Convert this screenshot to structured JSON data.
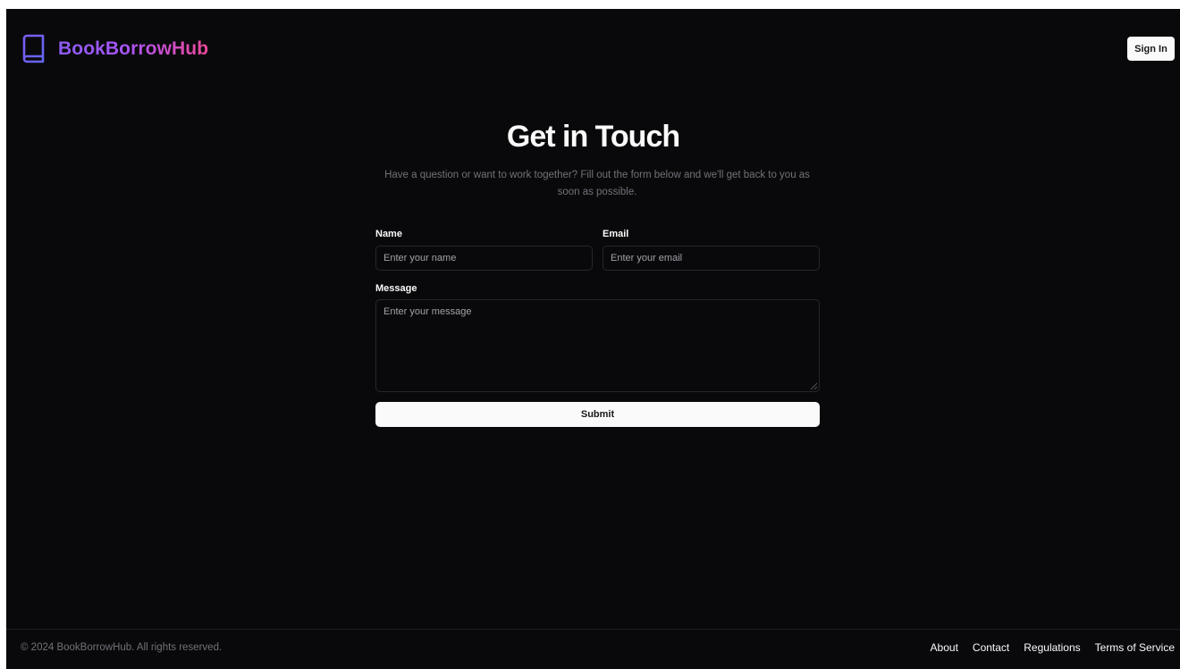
{
  "header": {
    "brand_name": "BookBorrowHub",
    "brand_icon": "book-icon",
    "signin_label": "Sign In"
  },
  "hero": {
    "title": "Get in Touch",
    "subtitle": "Have a question or want to work together? Fill out the form below and we'll get back to you as soon as possible."
  },
  "form": {
    "name_label": "Name",
    "name_placeholder": "Enter your name",
    "name_value": "",
    "email_label": "Email",
    "email_placeholder": "Enter your email",
    "email_value": "",
    "message_label": "Message",
    "message_placeholder": "Enter your message",
    "message_value": "",
    "submit_label": "Submit"
  },
  "footer": {
    "copyright": "© 2024 BookBorrowHub. All rights reserved.",
    "links": [
      "About",
      "Contact",
      "Regulations",
      "Terms of Service"
    ]
  },
  "colors": {
    "background": "#09090b",
    "brand_gradient_start": "#8b5cf6",
    "brand_gradient_end": "#ec4899",
    "button_bg": "#fafafa",
    "muted_text": "#71717a",
    "border": "#27272a"
  }
}
